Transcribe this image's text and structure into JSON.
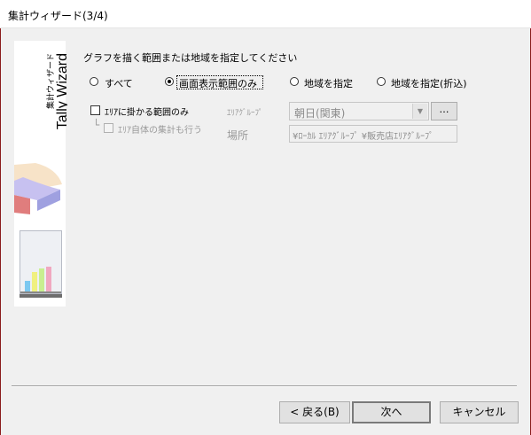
{
  "window": {
    "title": "集計ウィザード(3/4)"
  },
  "side": {
    "title_en": "Tally Wizard",
    "title_jp": "集計ウィザード"
  },
  "section": {
    "heading": "グラフを描く範囲または地域を指定してください"
  },
  "radios": [
    {
      "label": "すべて",
      "selected": false
    },
    {
      "label": "画面表示範囲のみ",
      "selected": true
    },
    {
      "label": "地域を指定",
      "selected": false
    },
    {
      "label": "地域を指定(折込)",
      "selected": false
    }
  ],
  "area_only": {
    "label": "ｴﾘｱに掛かる範囲のみ",
    "checked": false
  },
  "area_self": {
    "label": "ｴﾘｱ自体の集計も行う",
    "checked": false,
    "enabled": false
  },
  "area_group": {
    "label": "ｴﾘｱｸﾞﾙｰﾌﾟ",
    "value": "朝日(関東)",
    "browse_label": "…"
  },
  "location": {
    "label": "場所",
    "value": "¥ﾛｰｶﾙ ｴﾘｱｸﾞﾙｰﾌﾟ ¥販売店ｴﾘｱｸﾞﾙｰﾌﾟ"
  },
  "buttons": {
    "back": "< 戻る(B)",
    "next": "次へ",
    "cancel": "キャンセル"
  },
  "colors": {
    "pie_top": "#c7c1f0",
    "pie_side": "#9fa0e0",
    "pie_cream": "#f7e3c8",
    "pie_red": "#e07d7d",
    "bar_blue": "#7cc8f0",
    "bar_yellow": "#f0f080",
    "bar_lime": "#c8f090",
    "bar_pink": "#f0a8c0"
  }
}
